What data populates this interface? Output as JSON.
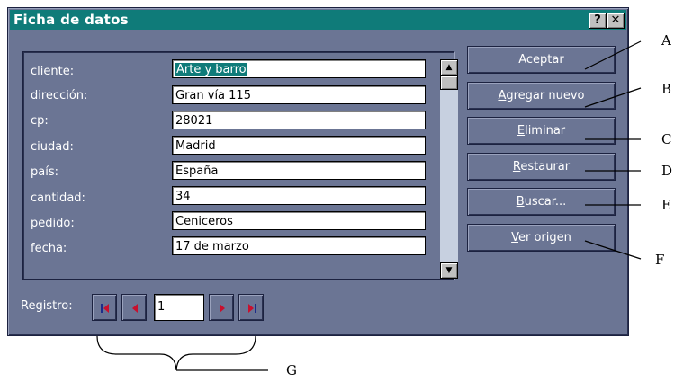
{
  "window": {
    "title": "Ficha de datos",
    "help_label": "?",
    "close_label": "✕"
  },
  "fields": [
    {
      "label": "cliente:",
      "value": "Arte y barro",
      "selected": true
    },
    {
      "label": "dirección:",
      "value": "Gran vía 115"
    },
    {
      "label": "cp:",
      "value": "28021"
    },
    {
      "label": "ciudad:",
      "value": "Madrid"
    },
    {
      "label": "país:",
      "value": "España"
    },
    {
      "label": "cantidad:",
      "value": "34"
    },
    {
      "label": "pedido:",
      "value": "Ceniceros"
    },
    {
      "label": "fecha:",
      "value": "17 de marzo"
    }
  ],
  "buttons": [
    {
      "label": "Aceptar",
      "mnemonic": ""
    },
    {
      "label": "Agregar nuevo",
      "mnemonic": "A"
    },
    {
      "label": "Eliminar",
      "mnemonic": "E"
    },
    {
      "label": "Restaurar",
      "mnemonic": "R"
    },
    {
      "label": "Buscar...",
      "mnemonic": "B"
    },
    {
      "label": "Ver origen",
      "mnemonic": "V"
    }
  ],
  "navigation": {
    "label": "Registro:",
    "record": "1"
  },
  "callouts": [
    "A",
    "B",
    "C",
    "D",
    "E",
    "F",
    "G"
  ],
  "colors": {
    "titlebar": "#0f7b79",
    "dialog_bg": "#6b7594",
    "nav_red": "#c8102e",
    "nav_blue": "#1d2c8a"
  }
}
